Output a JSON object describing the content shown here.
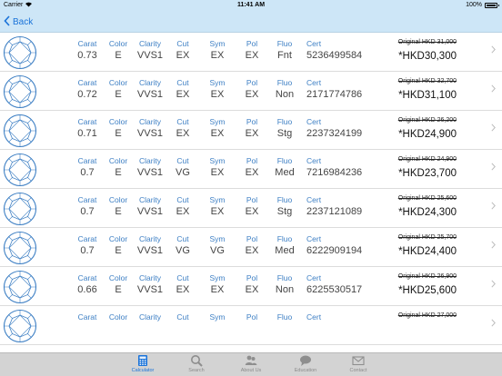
{
  "status_bar": {
    "carrier": "Carrier",
    "time": "11:41 AM",
    "battery": "100%"
  },
  "nav": {
    "back_label": "Back"
  },
  "columns": {
    "carat": "Carat",
    "color": "Color",
    "clarity": "Clarity",
    "cut": "Cut",
    "sym": "Sym",
    "pol": "Pol",
    "fluo": "Fluo",
    "cert": "Cert"
  },
  "original_prefix": "Original ",
  "diamonds": [
    {
      "carat": "0.73",
      "color": "E",
      "clarity": "VVS1",
      "cut": "EX",
      "sym": "EX",
      "pol": "EX",
      "fluo": "Fnt",
      "cert": "5236499584",
      "original": "HKD 31,000",
      "price": "*HKD30,300"
    },
    {
      "carat": "0.72",
      "color": "E",
      "clarity": "VVS1",
      "cut": "EX",
      "sym": "EX",
      "pol": "EX",
      "fluo": "Non",
      "cert": "2171774786",
      "original": "HKD 32,700",
      "price": "*HKD31,100"
    },
    {
      "carat": "0.71",
      "color": "E",
      "clarity": "VVS1",
      "cut": "EX",
      "sym": "EX",
      "pol": "EX",
      "fluo": "Stg",
      "cert": "2237324199",
      "original": "HKD 26,200",
      "price": "*HKD24,900"
    },
    {
      "carat": "0.7",
      "color": "E",
      "clarity": "VVS1",
      "cut": "VG",
      "sym": "EX",
      "pol": "EX",
      "fluo": "Med",
      "cert": "7216984236",
      "original": "HKD 24,900",
      "price": "*HKD23,700"
    },
    {
      "carat": "0.7",
      "color": "E",
      "clarity": "VVS1",
      "cut": "EX",
      "sym": "EX",
      "pol": "EX",
      "fluo": "Stg",
      "cert": "2237121089",
      "original": "HKD 25,600",
      "price": "*HKD24,300"
    },
    {
      "carat": "0.7",
      "color": "E",
      "clarity": "VVS1",
      "cut": "VG",
      "sym": "VG",
      "pol": "EX",
      "fluo": "Med",
      "cert": "6222909194",
      "original": "HKD 25,700",
      "price": "*HKD24,400"
    },
    {
      "carat": "0.66",
      "color": "E",
      "clarity": "VVS1",
      "cut": "EX",
      "sym": "EX",
      "pol": "EX",
      "fluo": "Non",
      "cert": "6225530517",
      "original": "HKD 26,900",
      "price": "*HKD25,600"
    },
    {
      "carat": "",
      "color": "",
      "clarity": "",
      "cut": "",
      "sym": "",
      "pol": "",
      "fluo": "",
      "cert": "",
      "original": "HKD 27,000",
      "price": ""
    }
  ],
  "tabs": [
    {
      "label": "Calculator",
      "icon": "calculator-icon",
      "active": true
    },
    {
      "label": "Search",
      "icon": "search-icon",
      "active": false
    },
    {
      "label": "About Us",
      "icon": "people-icon",
      "active": false
    },
    {
      "label": "Education",
      "icon": "chat-bubble-icon",
      "active": false
    },
    {
      "label": "Contact",
      "icon": "envelope-icon",
      "active": false
    }
  ],
  "colors": {
    "accent": "#1a73d9",
    "label": "#3d7fc4",
    "bar": "#cde6f7",
    "tab_bar": "#d3d3d3"
  }
}
